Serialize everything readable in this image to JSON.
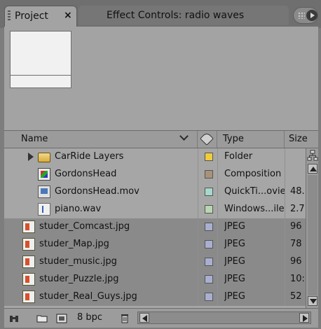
{
  "tabs": {
    "project_label": "Project",
    "project_close": "×",
    "effects_label": "Effect Controls: radio waves"
  },
  "columns": {
    "name": "Name",
    "type": "Type",
    "size": "Size"
  },
  "rows": [
    {
      "name": "CarRide Layers",
      "type": "Folder",
      "size": "",
      "icon": "folder-icon",
      "swatch": "#f0cc3a",
      "selected": false
    },
    {
      "name": "GordonsHead",
      "type": "Composition",
      "size": "",
      "icon": "composition-icon",
      "swatch": "#a8927a",
      "selected": false
    },
    {
      "name": "GordonsHead.mov",
      "type": "QuickTi...ovie",
      "size": "48.",
      "icon": "quicktime-movie-icon",
      "swatch": "#a6d8cc",
      "selected": false
    },
    {
      "name": "piano.wav",
      "type": "Windows...ile",
      "size": "2.7",
      "icon": "audio-file-icon",
      "swatch": "#b9d6b0",
      "selected": false
    },
    {
      "name": "studer_Comcast.jpg",
      "type": "JPEG",
      "size": "96",
      "icon": "jpeg-file-icon",
      "swatch": "#a9afd0",
      "selected": true
    },
    {
      "name": "studer_Map.jpg",
      "type": "JPEG",
      "size": "78",
      "icon": "jpeg-file-icon",
      "swatch": "#a9afd0",
      "selected": true
    },
    {
      "name": "studer_music.jpg",
      "type": "JPEG",
      "size": "96",
      "icon": "jpeg-file-icon",
      "swatch": "#a9afd0",
      "selected": true
    },
    {
      "name": "studer_Puzzle.jpg",
      "type": "JPEG",
      "size": "10:",
      "icon": "jpeg-file-icon",
      "swatch": "#a9afd0",
      "selected": true
    },
    {
      "name": "studer_Real_Guys.jpg",
      "type": "JPEG",
      "size": "52",
      "icon": "jpeg-file-icon",
      "swatch": "#a9afd0",
      "selected": true
    }
  ],
  "bottombar": {
    "bpc_label": "8 bpc"
  }
}
